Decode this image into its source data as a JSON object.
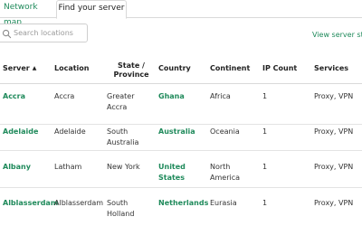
{
  "tabs": [
    {
      "label": "Network map"
    },
    {
      "label": "Find your server"
    }
  ],
  "search": {
    "placeholder": "Search locations",
    "value": ""
  },
  "view_status_label": "View server status",
  "table": {
    "headers": {
      "server": "Server",
      "location": "Location",
      "state_line1": "State /",
      "state_line2": "Province",
      "country": "Country",
      "continent": "Continent",
      "ip_count": "IP Count",
      "services": "Services"
    },
    "rows": [
      {
        "server": "Accra",
        "location": "Accra",
        "state1": "Greater",
        "state2": "Accra",
        "country1": "Ghana",
        "country2": "",
        "continent1": "Africa",
        "continent2": "",
        "ip_count": "1",
        "services": "Proxy, VPN"
      },
      {
        "server": "Adelaide",
        "location": "Adelaide",
        "state1": "South",
        "state2": "Australia",
        "country1": "Australia",
        "country2": "",
        "continent1": "Oceania",
        "continent2": "",
        "ip_count": "1",
        "services": "Proxy, VPN"
      },
      {
        "server": "Albany",
        "location": "Latham",
        "state1": "New York",
        "state2": "",
        "country1": "United",
        "country2": "States",
        "continent1": "North",
        "continent2": "America",
        "ip_count": "1",
        "services": "Proxy, VPN"
      },
      {
        "server": "Alblasserdam",
        "location": "Alblasserdam",
        "state1": "South",
        "state2": "Holland",
        "country1": "Netherlands",
        "country2": "",
        "continent1": "Eurasia",
        "continent2": "",
        "ip_count": "1",
        "services": "Proxy, VPN"
      }
    ]
  },
  "colors": {
    "accent": "#1f8a5b",
    "text": "#222222",
    "border": "#d9d9d9"
  }
}
